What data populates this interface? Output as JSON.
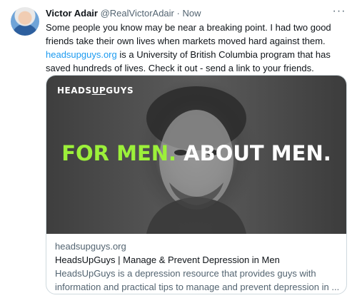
{
  "tweet": {
    "author_name": "Victor Adair",
    "handle": "@RealVictorAdair",
    "separator": "·",
    "time": "Now",
    "more_label": "···",
    "text_part1": "Some people you know may be near a breaking point. I had two good friends take their own lives when markets moved hard against them.",
    "text_link": "headsupguys.org",
    "text_part2": " is a University of British Columbia program that has saved hundreds of lives. Check it out - send a link to your friends."
  },
  "card": {
    "brand_prefix": "HEADS",
    "brand_mid": "UP",
    "brand_suffix": "GUYS",
    "headline_green": "FOR MEN.",
    "headline_white": " ABOUT MEN.",
    "domain": "headsupguys.org",
    "title": "HeadsUpGuys | Manage & Prevent Depression in Men",
    "description_line1": "HeadsUpGuys is a depression resource that provides guys with",
    "description_line2": "information and practical tips to manage and prevent depression in ..."
  },
  "colors": {
    "link": "#1d9bf0",
    "secondary_text": "#536471",
    "headline_green": "#9cf03a",
    "card_border": "#cfd9de"
  }
}
